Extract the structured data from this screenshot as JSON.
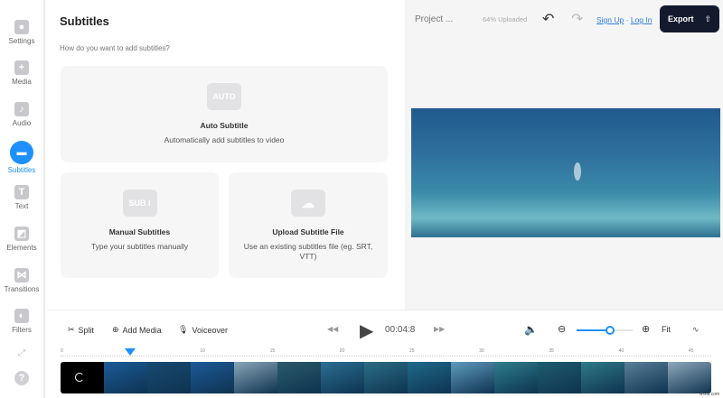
{
  "sidebar": {
    "items": [
      {
        "label": "Settings",
        "icon": "gear-icon",
        "glyph": "●"
      },
      {
        "label": "Media",
        "icon": "plus-icon",
        "glyph": "+"
      },
      {
        "label": "Audio",
        "icon": "music-note-icon",
        "glyph": "♪"
      },
      {
        "label": "Subtitles",
        "icon": "subtitles-icon",
        "glyph": "▬",
        "active": true
      },
      {
        "label": "Text",
        "icon": "text-icon",
        "glyph": "T"
      },
      {
        "label": "Elements",
        "icon": "elements-icon",
        "glyph": "◩"
      },
      {
        "label": "Transitions",
        "icon": "transitions-icon",
        "glyph": "⋈"
      },
      {
        "label": "Filters",
        "icon": "filters-icon",
        "glyph": "◐"
      }
    ],
    "help_glyph": "?",
    "collapse_glyph": "⤢"
  },
  "panel": {
    "title": "Subtitles",
    "question": "How do you want to add subtitles?",
    "cards": [
      {
        "icon_text": "AUTO",
        "title": "Auto Subtitle",
        "desc": "Automatically add subtitles to video"
      },
      {
        "icon_text": "SUB I",
        "title": "Manual Subtitles",
        "desc": "Type your subtitles manually"
      },
      {
        "icon_text": "☁",
        "title": "Upload Subtitle File",
        "desc": "Use an existing subtitles file (eg. SRT, VTT)"
      }
    ]
  },
  "header": {
    "project": "Project ...",
    "upload_status": "64% Uploaded",
    "upload_progress": 64,
    "sign_up": "Sign Up",
    "separator": "·",
    "log_in": "Log In",
    "export": "Export",
    "undo": "↶",
    "redo": "↷"
  },
  "toolbar": {
    "split": "Split",
    "add_media": "Add Media",
    "voiceover": "Voiceover",
    "time": "00:04:8",
    "fit": "Fit",
    "zoom_level": 0.6
  },
  "timeline": {
    "ticks": [
      "0",
      "5",
      "10",
      "15",
      "20",
      "25",
      "30",
      "35",
      "40",
      "45"
    ],
    "playhead_seconds": 5,
    "watermark": "wfxid.com"
  },
  "colors": {
    "accent": "#1e90ff",
    "export_bg": "#141a2e",
    "link": "#2a7de1"
  }
}
